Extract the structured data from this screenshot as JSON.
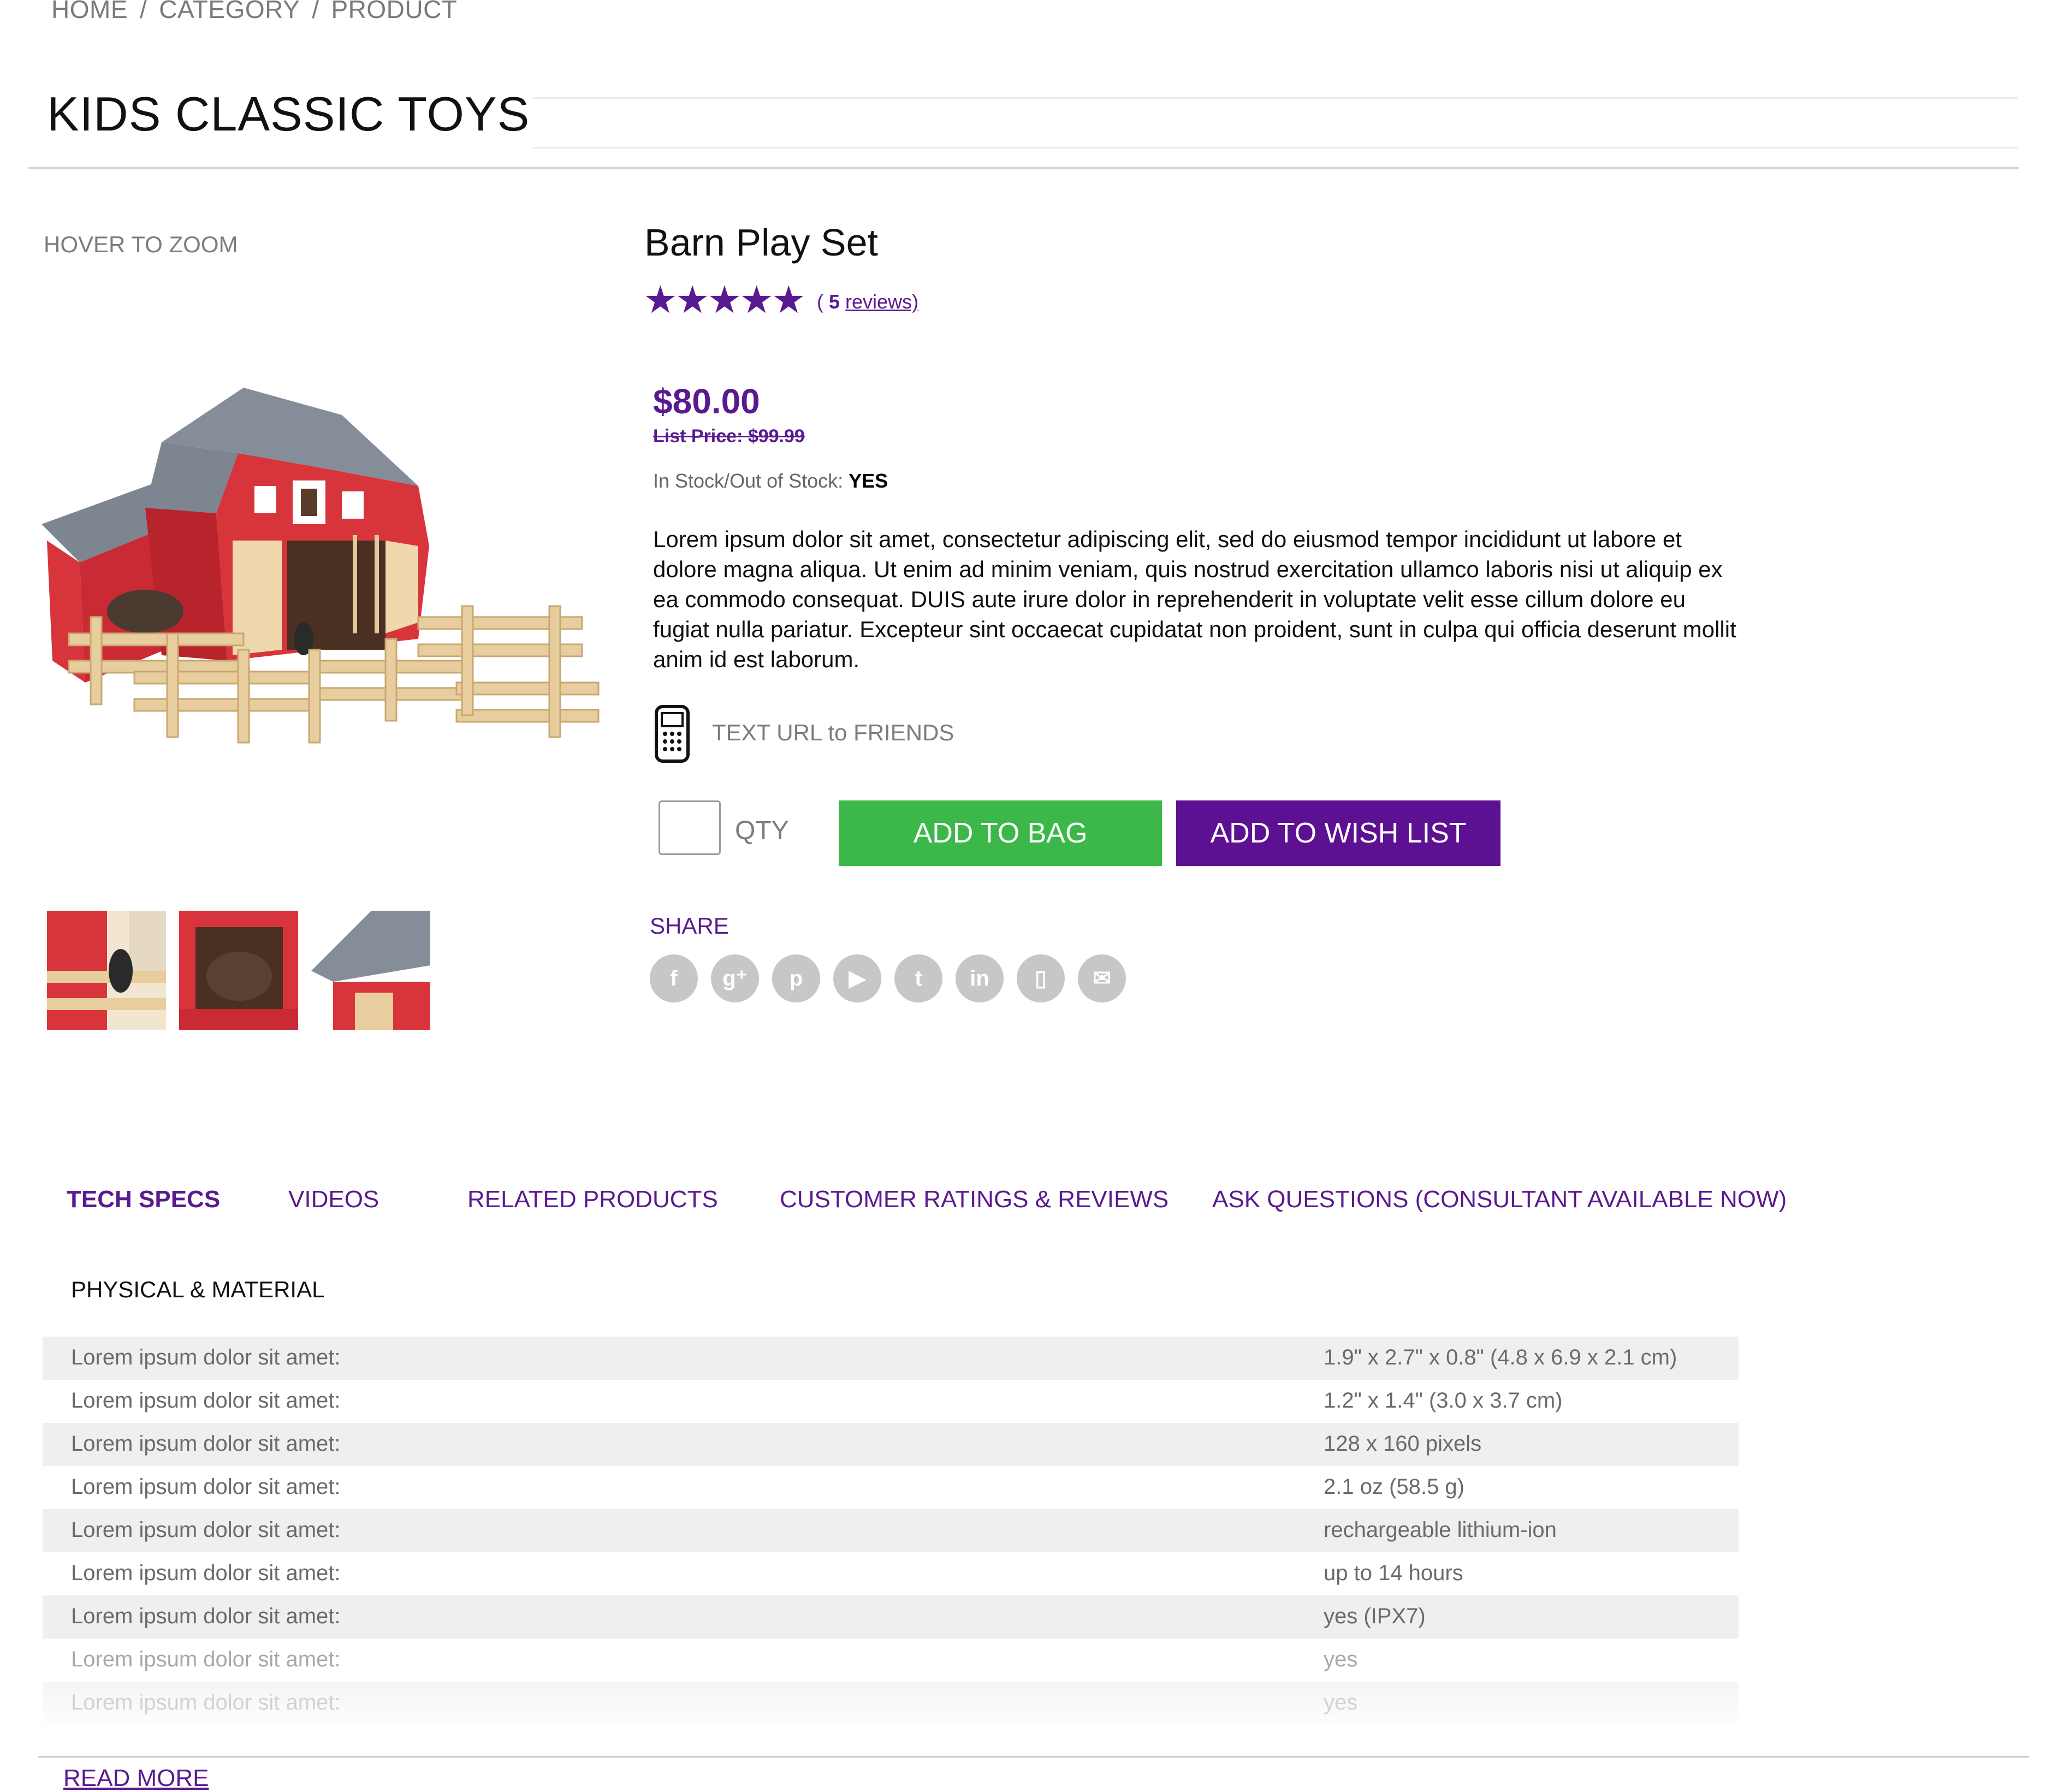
{
  "breadcrumb": {
    "items": [
      "HOME",
      "CATEGORY",
      "PRODUCT"
    ],
    "separator": "/"
  },
  "page": {
    "title": "KIDS CLASSIC TOYS"
  },
  "gallery": {
    "hover_label": "HOVER TO ZOOM"
  },
  "product": {
    "name": "Barn Play Set",
    "rating_stars": "★★★★★",
    "rating_value": 5,
    "reviews_open": "( ",
    "reviews_count": "5",
    "reviews_label": "reviews)",
    "price": "$80.00",
    "list_price": "List Price: $99.99",
    "stock_label": "In Stock/Out of Stock: ",
    "stock_value": "YES",
    "description": "Lorem ipsum dolor sit amet, consectetur adipiscing elit, sed do eiusmod tempor incididunt ut labore et dolore magna aliqua. Ut enim ad minim veniam, quis nostrud exercitation ullamco laboris nisi ut aliquip ex ea commodo consequat. DUIS aute irure dolor in reprehenderit in voluptate velit esse cillum dolore eu fugiat nulla pariatur. Excepteur sint occaecat cupidatat non proident, sunt in culpa qui officia deserunt mollit anim id est laborum.",
    "text_url_label": "TEXT URL to FRIENDS"
  },
  "actions": {
    "qty_value": "",
    "qty_label": "QTY",
    "add_to_bag": "ADD TO BAG",
    "add_to_wish_list": "ADD TO WISH LIST"
  },
  "share": {
    "label": "SHARE",
    "icons": [
      "facebook-icon",
      "google-plus-icon",
      "pinterest-icon",
      "youtube-icon",
      "twitter-icon",
      "linkedin-icon",
      "mobile-icon",
      "email-icon"
    ]
  },
  "tabs": [
    {
      "label": "TECH SPECS",
      "active": true
    },
    {
      "label": "VIDEOS",
      "active": false
    },
    {
      "label": "RELATED PRODUCTS",
      "active": false
    },
    {
      "label": "CUSTOMER RATINGS & REVIEWS",
      "active": false
    },
    {
      "label": "ASK QUESTIONS (CONSULTANT AVAILABLE NOW)",
      "active": false
    }
  ],
  "specs": {
    "section_title": "PHYSICAL & MATERIAL",
    "rows": [
      {
        "key": "Lorem ipsum dolor sit amet:",
        "value": "1.9\" x 2.7\" x 0.8\" (4.8 x 6.9 x 2.1 cm)"
      },
      {
        "key": "Lorem ipsum dolor sit amet:",
        "value": "1.2\" x 1.4\" (3.0 x 3.7 cm)"
      },
      {
        "key": "Lorem ipsum dolor sit amet:",
        "value": "128 x 160 pixels"
      },
      {
        "key": "Lorem ipsum dolor sit amet:",
        "value": "2.1 oz (58.5 g)"
      },
      {
        "key": "Lorem ipsum dolor sit amet:",
        "value": "rechargeable lithium-ion"
      },
      {
        "key": "Lorem ipsum dolor sit amet:",
        "value": "up to 14 hours"
      },
      {
        "key": "Lorem ipsum dolor sit amet:",
        "value": "yes (IPX7)"
      },
      {
        "key": "Lorem ipsum dolor sit amet:",
        "value": "yes"
      },
      {
        "key": "Lorem ipsum dolor sit amet:",
        "value": "yes"
      }
    ],
    "read_more": "READ MORE"
  },
  "colors": {
    "accent": "#5a1a8f",
    "bag_button": "#3cb84a",
    "wish_button": "#5c1192"
  }
}
